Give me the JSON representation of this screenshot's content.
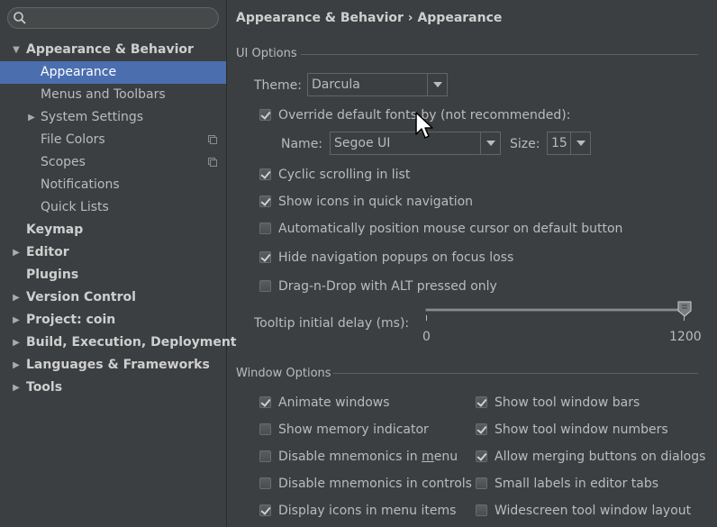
{
  "search": {
    "value": ""
  },
  "sidebar": {
    "items": [
      {
        "label": "Appearance & Behavior",
        "bold": true,
        "arrow": "▼",
        "indent": 0
      },
      {
        "label": "Appearance",
        "bold": false,
        "arrow": "",
        "indent": 1,
        "selected": true
      },
      {
        "label": "Menus and Toolbars",
        "bold": false,
        "arrow": "",
        "indent": 1
      },
      {
        "label": "System Settings",
        "bold": false,
        "arrow": "▶",
        "indent": 1
      },
      {
        "label": "File Colors",
        "bold": false,
        "arrow": "",
        "indent": 1,
        "project_icon": true
      },
      {
        "label": "Scopes",
        "bold": false,
        "arrow": "",
        "indent": 1,
        "project_icon": true
      },
      {
        "label": "Notifications",
        "bold": false,
        "arrow": "",
        "indent": 1
      },
      {
        "label": "Quick Lists",
        "bold": false,
        "arrow": "",
        "indent": 1
      },
      {
        "label": "Keymap",
        "bold": true,
        "arrow": "",
        "indent": 0
      },
      {
        "label": "Editor",
        "bold": true,
        "arrow": "▶",
        "indent": 0
      },
      {
        "label": "Plugins",
        "bold": true,
        "arrow": "",
        "indent": 0
      },
      {
        "label": "Version Control",
        "bold": true,
        "arrow": "▶",
        "indent": 0
      },
      {
        "label": "Project: coin",
        "bold": true,
        "arrow": "▶",
        "indent": 0
      },
      {
        "label": "Build, Execution, Deployment",
        "bold": true,
        "arrow": "▶",
        "indent": 0
      },
      {
        "label": "Languages & Frameworks",
        "bold": true,
        "arrow": "▶",
        "indent": 0
      },
      {
        "label": "Tools",
        "bold": true,
        "arrow": "▶",
        "indent": 0
      }
    ]
  },
  "breadcrumb": {
    "parent": "Appearance & Behavior",
    "sep": "›",
    "current": "Appearance"
  },
  "ui_options": {
    "title": "UI Options",
    "theme_label": "Theme:",
    "theme_value": "Darcula",
    "override_fonts": {
      "label": "Override default fonts by (not recommended):",
      "checked": true
    },
    "name_label": "Name:",
    "name_value": "Segoe UI",
    "size_label": "Size:",
    "size_value": "15",
    "checkboxes": [
      {
        "label": "Cyclic scrolling in list",
        "checked": true
      },
      {
        "label": "Show icons in quick navigation",
        "checked": true
      },
      {
        "label": "Automatically position mouse cursor on default button",
        "checked": false
      },
      {
        "label": "Hide navigation popups on focus loss",
        "checked": true
      },
      {
        "label": "Drag-n-Drop with ALT pressed only",
        "checked": false
      }
    ],
    "tooltip_label": "Tooltip initial delay (ms):",
    "tooltip_min": "0",
    "tooltip_max": "1200",
    "tooltip_value": 1200
  },
  "window_options": {
    "title": "Window Options",
    "left": [
      {
        "label": "Animate windows",
        "checked": true
      },
      {
        "label": "Show memory indicator",
        "checked": false
      },
      {
        "pre": "Disable mnemonics in ",
        "u": "m",
        "post": "enu",
        "checked": false
      },
      {
        "label": "Disable mnemonics in controls",
        "checked": false
      },
      {
        "label": "Display icons in menu items",
        "checked": true
      }
    ],
    "right": [
      {
        "label": "Show tool window bars",
        "checked": true
      },
      {
        "label": "Show tool window numbers",
        "checked": true
      },
      {
        "label": "Allow merging buttons on dialogs",
        "checked": true
      },
      {
        "label": "Small labels in editor tabs",
        "checked": false
      },
      {
        "label": "Widescreen tool window layout",
        "checked": false
      }
    ]
  }
}
